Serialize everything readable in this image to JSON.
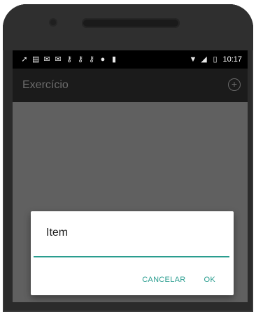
{
  "status_bar": {
    "left_icons": [
      "navigation-icon",
      "notification-icon",
      "mail-icon",
      "mail-icon",
      "key-icon",
      "key-icon",
      "key-icon",
      "circle-icon",
      "sd-card-icon"
    ],
    "right_icons": [
      "wifi-icon",
      "signal-icon",
      "battery-icon"
    ],
    "time": "10:17"
  },
  "app_bar": {
    "title": "Exercício",
    "add_icon": "plus-circle-icon"
  },
  "dialog": {
    "title": "Item",
    "input_value": "",
    "cancel_label": "CANCELAR",
    "ok_label": "OK"
  },
  "colors": {
    "accent": "#2a9d8f",
    "appbar": "#1b1b1b",
    "scrim": "#606060"
  }
}
